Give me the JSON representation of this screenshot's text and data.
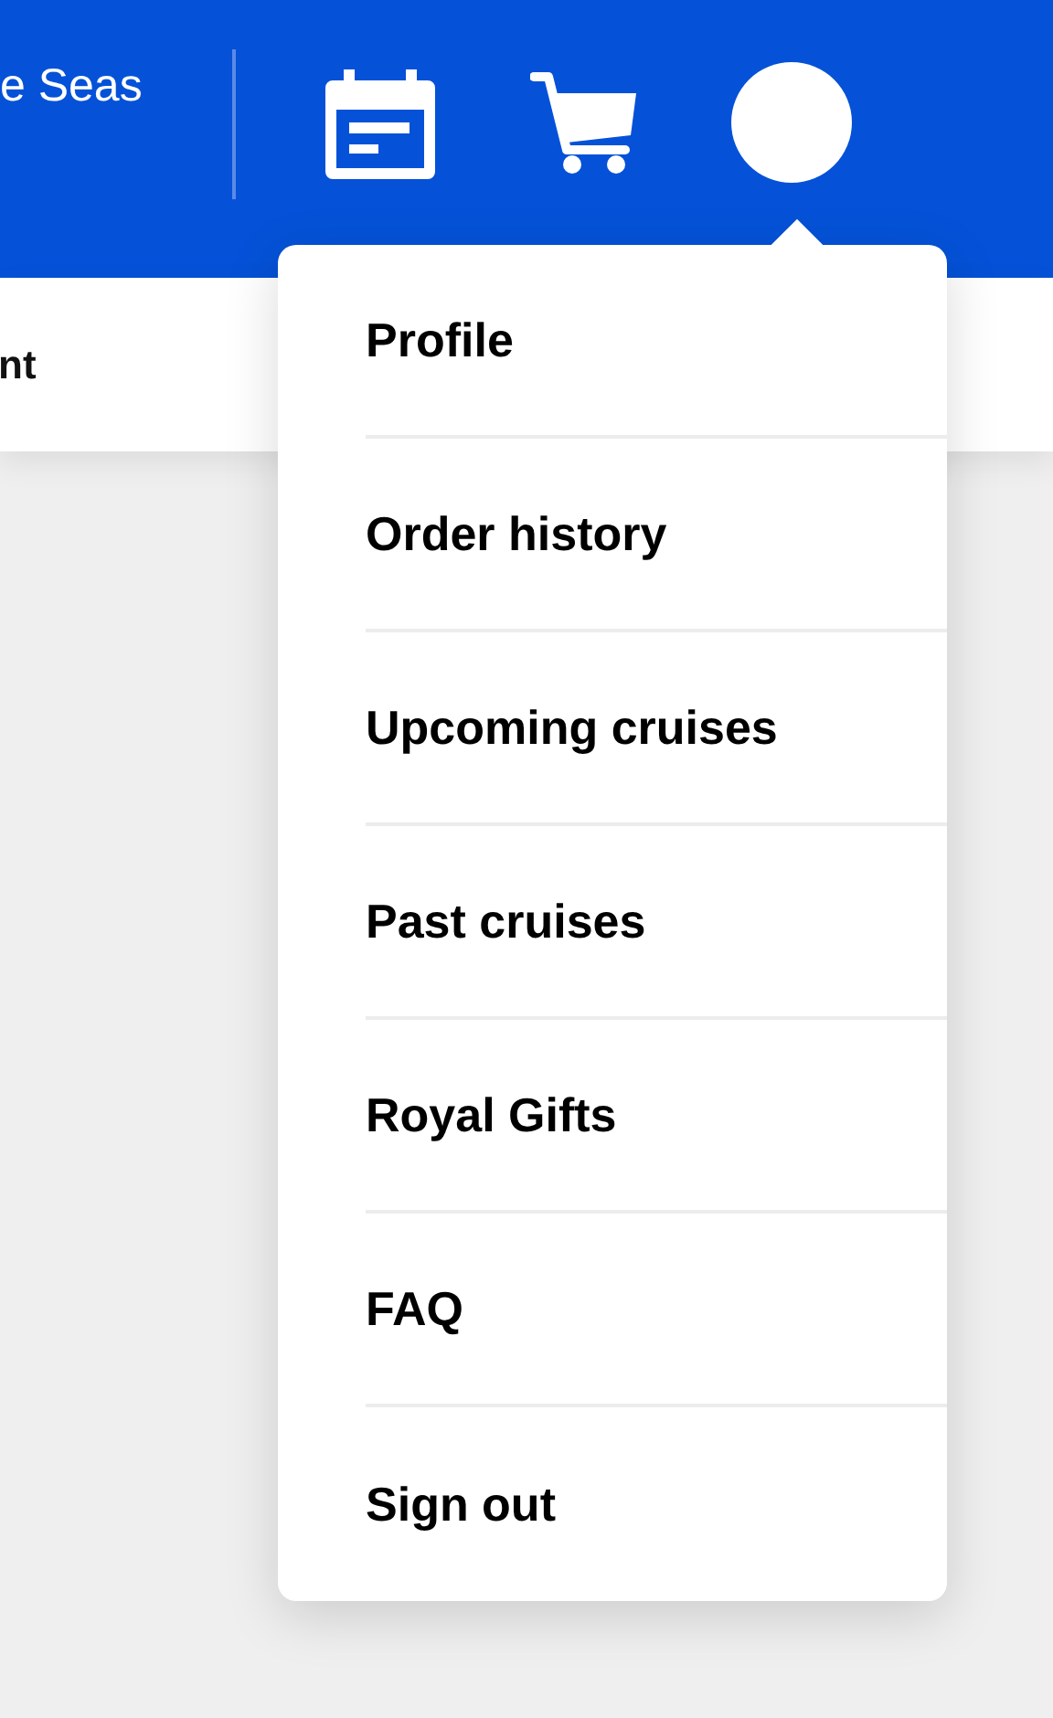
{
  "header": {
    "brand_text": "e Seas"
  },
  "subbar": {
    "text": "nt"
  },
  "account_menu": {
    "items": [
      {
        "label": "Profile"
      },
      {
        "label": "Order history"
      },
      {
        "label": "Upcoming cruises"
      },
      {
        "label": "Past cruises"
      },
      {
        "label": "Royal Gifts"
      },
      {
        "label": "FAQ"
      },
      {
        "label": "Sign out"
      }
    ]
  }
}
